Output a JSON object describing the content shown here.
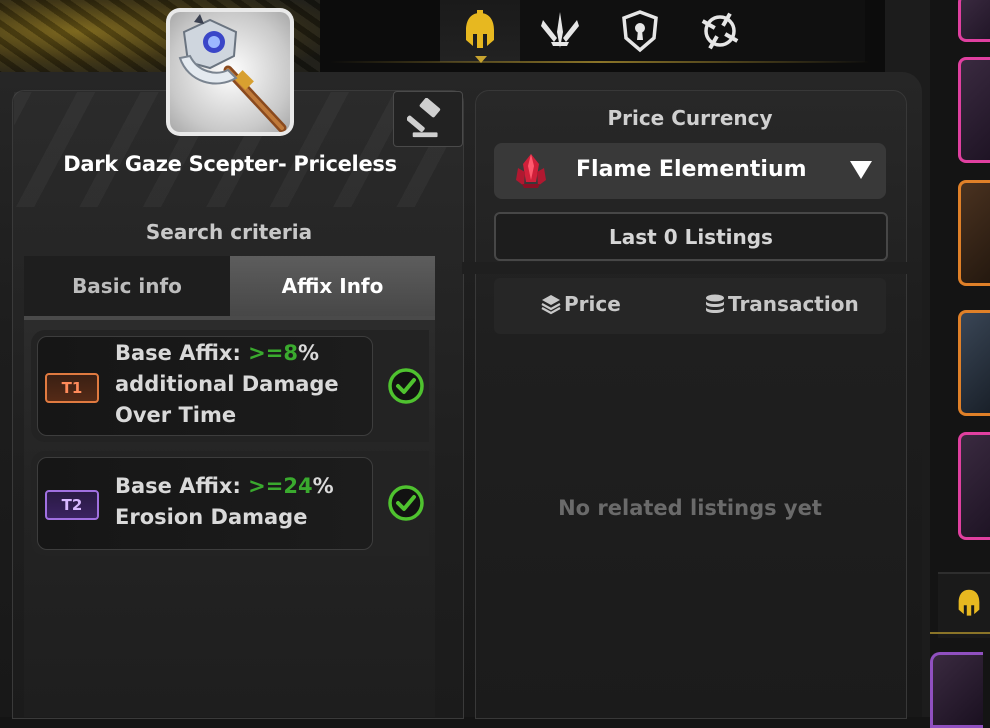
{
  "item": {
    "name": "Dark Gaze Scepter- Priceless"
  },
  "class_tabs": [
    {
      "icon": "spartan-helmet-icon",
      "active": true
    },
    {
      "icon": "crossed-blades-icon",
      "active": false
    },
    {
      "icon": "shield-icon",
      "active": false
    },
    {
      "icon": "crosshair-icon",
      "active": false
    }
  ],
  "search": {
    "title": "Search criteria",
    "tabs": [
      {
        "label": "Basic info",
        "active": false
      },
      {
        "label": "Affix Info",
        "active": true
      }
    ],
    "affixes": [
      {
        "tier": "T1",
        "prefix": "Base Affix: ",
        "op": ">=",
        "value": "8",
        "suffix_line1": "%",
        "line2": "additional Damage",
        "line3": "Over Time",
        "checked": true
      },
      {
        "tier": "T2",
        "prefix": "Base Affix: ",
        "op": ">=",
        "value": "24",
        "suffix_line1": "%",
        "line2": "Erosion Damage",
        "line3": "",
        "checked": true
      }
    ]
  },
  "price": {
    "label": "Price Currency",
    "currency": "Flame Elementium",
    "currency_icon": "red-crystal-icon",
    "listings_label": "Last 0 Listings",
    "sort_price": "Price",
    "sort_transaction": "Transaction",
    "empty_message": "No related listings yet"
  },
  "colors": {
    "accent_gold": "#c8a430",
    "affix_value_green": "#3aaa2e",
    "tier1": "#e07a40",
    "tier2": "#a070e0",
    "check_green": "#4fc22f"
  }
}
